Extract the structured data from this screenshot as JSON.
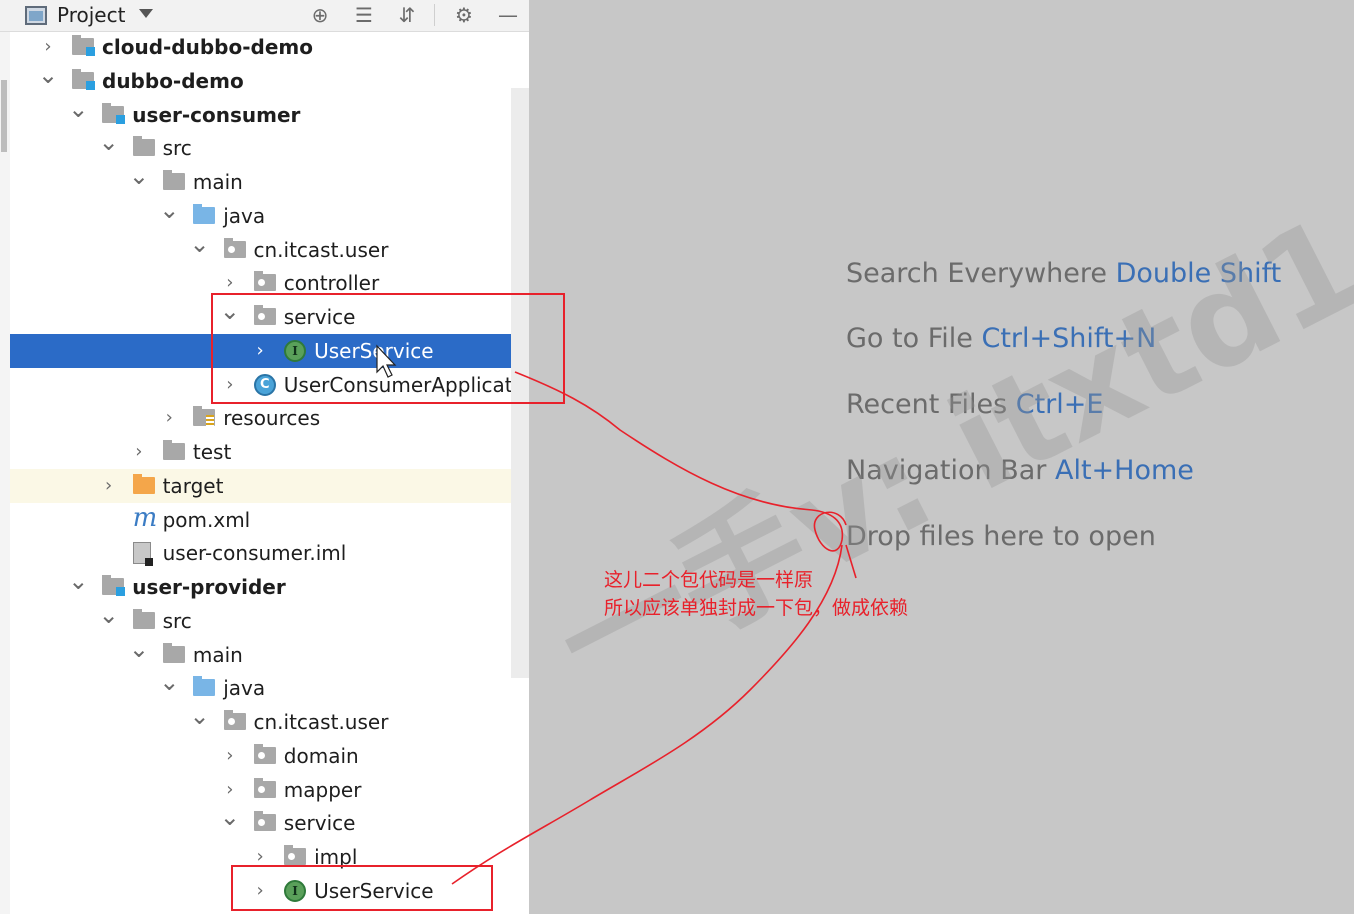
{
  "header": {
    "title": "Project",
    "icons": [
      "locate-icon",
      "expand-all-icon",
      "collapse-all-icon",
      "gear-icon",
      "minimize-icon"
    ]
  },
  "tree": [
    {
      "label": "cloud-dubbo-demo",
      "icon": "module-folder",
      "expanded": false,
      "bold": true
    },
    {
      "label": "dubbo-demo",
      "icon": "module-folder",
      "expanded": true,
      "bold": true
    },
    {
      "label": "user-consumer",
      "icon": "module-folder",
      "expanded": true,
      "bold": true
    },
    {
      "label": "src",
      "icon": "folder",
      "expanded": true
    },
    {
      "label": "main",
      "icon": "folder",
      "expanded": true
    },
    {
      "label": "java",
      "icon": "source-folder",
      "expanded": true
    },
    {
      "label": "cn.itcast.user",
      "icon": "package-folder",
      "expanded": true
    },
    {
      "label": "controller",
      "icon": "package-folder",
      "expanded": false
    },
    {
      "label": "service",
      "icon": "package-folder",
      "expanded": true
    },
    {
      "label": "UserService",
      "icon": "interface",
      "expanded": false,
      "selected": true
    },
    {
      "label": "UserConsumerApplicatio",
      "icon": "spring-class",
      "expanded": false
    },
    {
      "label": "resources",
      "icon": "resources-folder",
      "expanded": false
    },
    {
      "label": "test",
      "icon": "folder",
      "expanded": false
    },
    {
      "label": "target",
      "icon": "excluded-folder",
      "expanded": false
    },
    {
      "label": "pom.xml",
      "icon": "maven-file"
    },
    {
      "label": "user-consumer.iml",
      "icon": "iml-file"
    },
    {
      "label": "user-provider",
      "icon": "module-folder",
      "expanded": true,
      "bold": true
    },
    {
      "label": "src",
      "icon": "folder",
      "expanded": true
    },
    {
      "label": "main",
      "icon": "folder",
      "expanded": true
    },
    {
      "label": "java",
      "icon": "source-folder",
      "expanded": true
    },
    {
      "label": "cn.itcast.user",
      "icon": "package-folder",
      "expanded": true
    },
    {
      "label": "domain",
      "icon": "package-folder",
      "expanded": false
    },
    {
      "label": "mapper",
      "icon": "package-folder",
      "expanded": false
    },
    {
      "label": "service",
      "icon": "package-folder",
      "expanded": true
    },
    {
      "label": "impl",
      "icon": "package-folder",
      "expanded": false
    },
    {
      "label": "UserService",
      "icon": "interface",
      "expanded": false
    }
  ],
  "editor_hints": [
    {
      "text": "Search Everywhere ",
      "key": "Double Shift"
    },
    {
      "text": "Go to File ",
      "key": "Ctrl+Shift+N"
    },
    {
      "text": "Recent Files ",
      "key": "Ctrl+E"
    },
    {
      "text": "Navigation Bar ",
      "key": "Alt+Home"
    },
    {
      "text": "Drop files here to open",
      "key": ""
    }
  ],
  "annotation": {
    "line1": "这儿二个包代码是一样原",
    "line2": "所以应该单独封成一下包，做成依赖",
    "color": "#e8212b"
  },
  "watermark": "一手v: itxtd1",
  "colors": {
    "selection": "#2b6bc7",
    "hint_key": "#3a6fb5",
    "hint_text": "#6b6b6b"
  }
}
